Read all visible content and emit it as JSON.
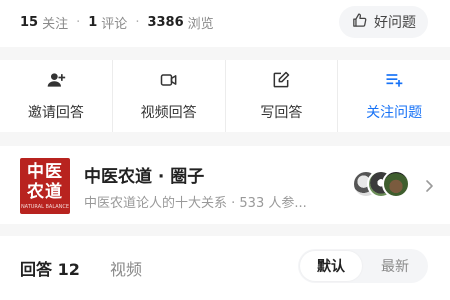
{
  "stats": {
    "follow_count": "15",
    "follow_label": "关注",
    "comment_count": "1",
    "comment_label": "评论",
    "view_count": "3386",
    "view_label": "浏览",
    "separator": "·"
  },
  "good_question_label": "好问题",
  "actions": [
    {
      "label": "邀请回答",
      "icon": "add-user-icon"
    },
    {
      "label": "视频回答",
      "icon": "video-camera-icon"
    },
    {
      "label": "写回答",
      "icon": "edit-icon"
    },
    {
      "label": "关注问题",
      "icon": "follow-list-icon"
    }
  ],
  "circle": {
    "logo_line1": "中医",
    "logo_line2": "农道",
    "logo_line3": "NATURAL BALANCE",
    "title": "中医农道 · 圈子",
    "subtitle": "中医农道论人的十大关系 · 533 人参..."
  },
  "tabs": {
    "answers_label": "回答 12",
    "video_label": "视频"
  },
  "sort": {
    "default_label": "默认",
    "latest_label": "最新"
  },
  "colors": {
    "accent": "#1772f6",
    "logo_red": "#b8231f",
    "muted": "#8a8a8a"
  }
}
